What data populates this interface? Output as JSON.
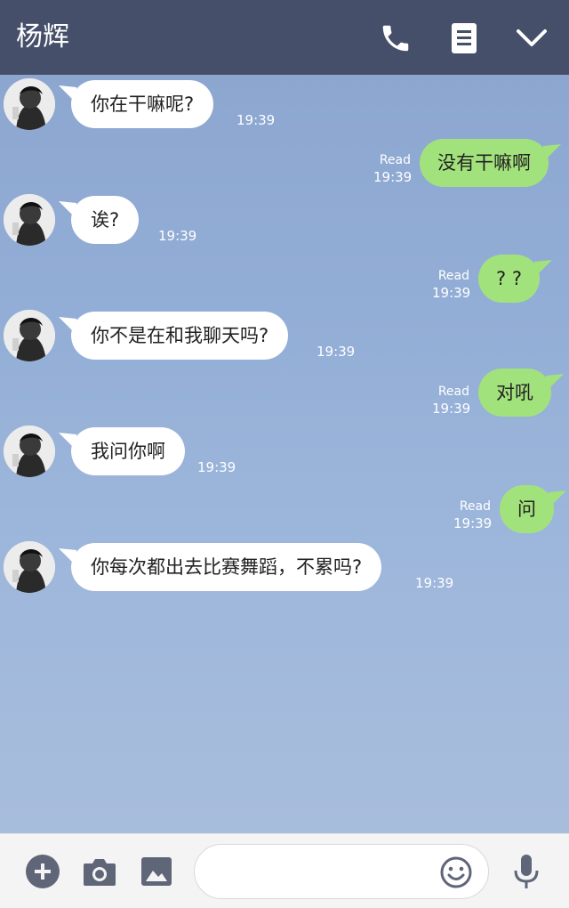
{
  "header": {
    "title": "杨辉",
    "icons": [
      "phone-icon",
      "notes-icon",
      "chevron-down-icon"
    ]
  },
  "messages": [
    {
      "side": "in",
      "text": "你在干嘛呢?",
      "time": "19:39"
    },
    {
      "side": "out",
      "text": "没有干嘛啊",
      "status": "Read",
      "time": "19:39"
    },
    {
      "side": "in",
      "text": "诶?",
      "time": "19:39"
    },
    {
      "side": "out",
      "text": "? ?",
      "status": "Read",
      "time": "19:39"
    },
    {
      "side": "in",
      "text": "你不是在和我聊天吗?",
      "time": "19:39"
    },
    {
      "side": "out",
      "text": "对吼",
      "status": "Read",
      "time": "19:39"
    },
    {
      "side": "in",
      "text": "我问你啊",
      "time": "19:39"
    },
    {
      "side": "out",
      "text": "问",
      "status": "Read",
      "time": "19:39"
    },
    {
      "side": "in",
      "text": "你每次都出去比赛舞蹈，不累吗?",
      "time": "19:39"
    }
  ],
  "input_bar": {
    "message_value": "",
    "icons": [
      "plus-icon",
      "camera-icon",
      "image-icon",
      "emoji-icon",
      "microphone-icon"
    ]
  },
  "colors": {
    "header_bg": "#454f69",
    "outgoing_bubble": "#a2e27c",
    "incoming_bubble": "#ffffff",
    "icon_gray": "#5f6678"
  }
}
